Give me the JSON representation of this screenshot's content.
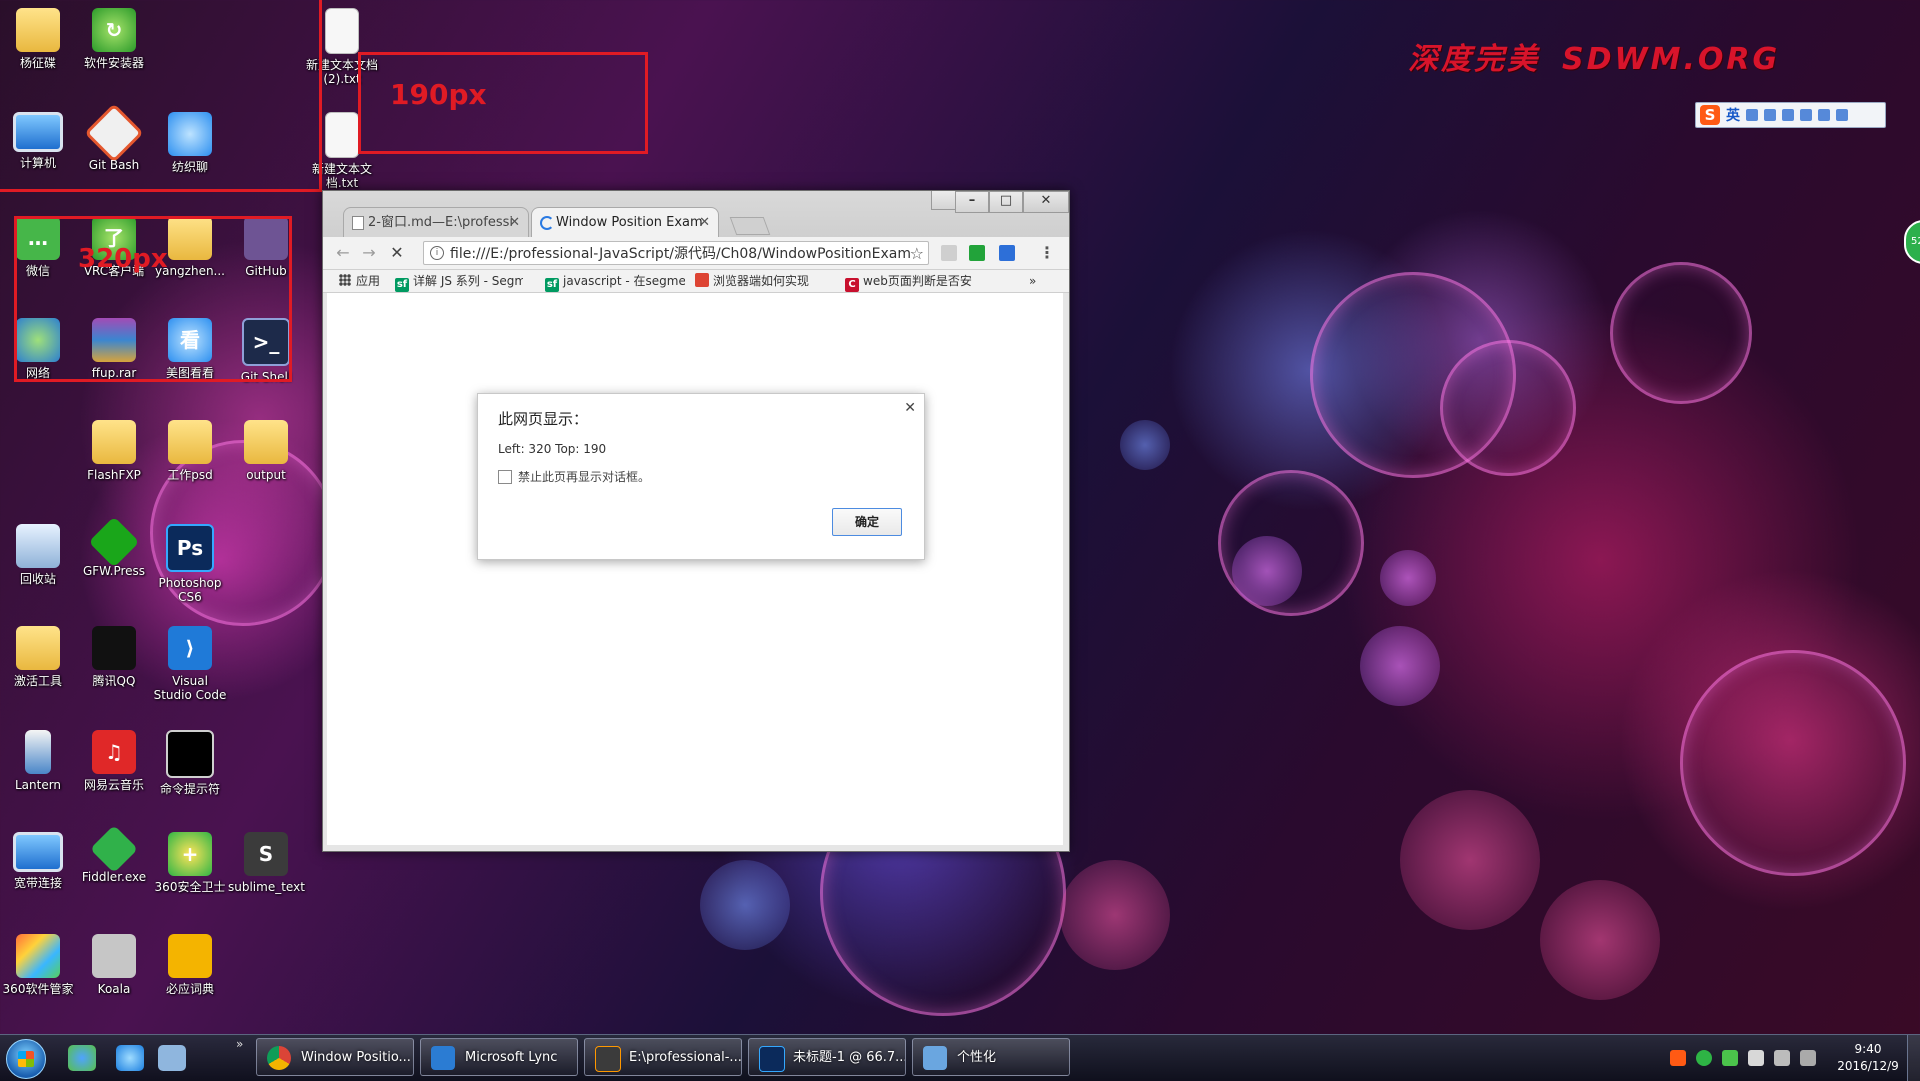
{
  "wallpaper": {
    "brand_cn": "深度完美",
    "brand_en": "SDWM.ORG"
  },
  "ime": {
    "mode": "英"
  },
  "side_badge": "52",
  "desktop_icons": [
    {
      "label": "杨征碟"
    },
    {
      "label": "软件安装器"
    },
    {
      "label": "新建文本文档 (2).txt"
    },
    {
      "label": "计算机"
    },
    {
      "label": "Git Bash"
    },
    {
      "label": "纺织聊"
    },
    {
      "label": "新建文本文档.txt"
    },
    {
      "label": "微信"
    },
    {
      "label": "VRC客户端"
    },
    {
      "label": "yangzhen..."
    },
    {
      "label": "GitHub"
    },
    {
      "label": "网络"
    },
    {
      "label": "ffup.rar"
    },
    {
      "label": "美图看看"
    },
    {
      "label": "Git Shell"
    },
    {
      "label": "FlashFXP"
    },
    {
      "label": "工作psd"
    },
    {
      "label": "output"
    },
    {
      "label": "回收站"
    },
    {
      "label": "GFW.Press"
    },
    {
      "label": "Photoshop CS6"
    },
    {
      "label": "激活工具"
    },
    {
      "label": "腾讯QQ"
    },
    {
      "label": "Visual Studio Code"
    },
    {
      "label": "Lantern"
    },
    {
      "label": "网易云音乐"
    },
    {
      "label": "命令提示符"
    },
    {
      "label": "宽带连接"
    },
    {
      "label": "Fiddler.exe"
    },
    {
      "label": "360安全卫士"
    },
    {
      "label": "sublime_text"
    },
    {
      "label": "360软件管家"
    },
    {
      "label": "Koala"
    },
    {
      "label": "必应词典"
    }
  ],
  "annotations": {
    "top_label": "190px",
    "left_label": "320px"
  },
  "browser": {
    "tabs": [
      {
        "label": "2-窗口.md—E:\\professi"
      },
      {
        "label": "Window Position Exam"
      }
    ],
    "url": "file:///E:/professional-JavaScript/源代码/Ch08/WindowPositionExam",
    "bookmarks": [
      {
        "label": "应用"
      },
      {
        "label": "详解 JS 系列 - Segm"
      },
      {
        "label": "javascript - 在segme"
      },
      {
        "label": "浏览器端如何实现"
      },
      {
        "label": "web页面判断是否安"
      }
    ],
    "overflow": "»"
  },
  "dialog": {
    "title": "此网页显示：",
    "message": "Left: 320 Top: 190",
    "checkbox_label": "禁止此页再显示对话框。",
    "ok_label": "确定"
  },
  "taskbar": {
    "more": "»",
    "tasks": [
      {
        "label": "Window Positio..."
      },
      {
        "label": "Microsoft Lync"
      },
      {
        "label": "E:\\professional-..."
      },
      {
        "label": "未标题-1 @ 66.7..."
      },
      {
        "label": "个性化"
      }
    ],
    "clock_time": "9:40",
    "clock_date": "2016/12/9"
  }
}
